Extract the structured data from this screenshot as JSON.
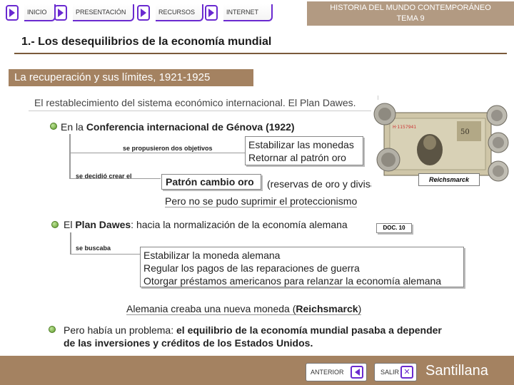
{
  "nav": {
    "inicio": "INICIO",
    "presentacion": "PRESENTACIÓN",
    "recursos": "RECURSOS",
    "internet": "INTERNET"
  },
  "header": {
    "line1": "HISTORIA DEL MUNDO CONTEMPORÁNEO",
    "line2": "TEMA 9"
  },
  "section_title": "1.- Los desequilibrios de la economía mundial",
  "subheader": "La recuperación y sus límites, 1921-1925",
  "intro": "El restablecimiento del sistema económico internacional. El Plan Dawes.",
  "genova": {
    "prefix": "En la ",
    "bold": "Conferencia internacional de Génova (1922)",
    "propusieron": "se propusieron dos objetivos",
    "objetivo1": "Estabilizar las monedas",
    "objetivo2": "Retornar al patrón oro",
    "decidio": "se decidió crear el",
    "patron": "Patrón cambio oro",
    "reservas": "(reservas de oro y divisas)",
    "proteccionismo": "Pero no se pudo suprimir el proteccionismo"
  },
  "image": {
    "badge": "Reichsmarck"
  },
  "dawes": {
    "prefix": "El ",
    "bold": "Plan Dawes",
    "rest": ": hacia la normalización de la economía alemana",
    "doc": "DOC. 10",
    "buscaba": "se buscaba",
    "item1": "Estabilizar la moneda alemana",
    "item2": "Regular los pagos de las reparaciones de guerra",
    "item3": "Otorgar préstamos americanos para relanzar la economía alemana",
    "alemania_prefix": "Alemania creaba una nueva moneda (",
    "alemania_bold": "Reichsmarck",
    "alemania_suffix": ")"
  },
  "problema": {
    "prefix": "Pero había un problema: ",
    "bold1": "el equilibrio de la economía mundial pasaba a depender",
    "bold2": "de las inversiones y créditos de los Estados Unidos."
  },
  "footer": {
    "anterior": "ANTERIOR",
    "salir": "SALIR",
    "brand": "Santillana"
  },
  "colors": {
    "accent": "#6a2ad0",
    "brown": "#a48261",
    "bullet": "#5e9a2a"
  }
}
